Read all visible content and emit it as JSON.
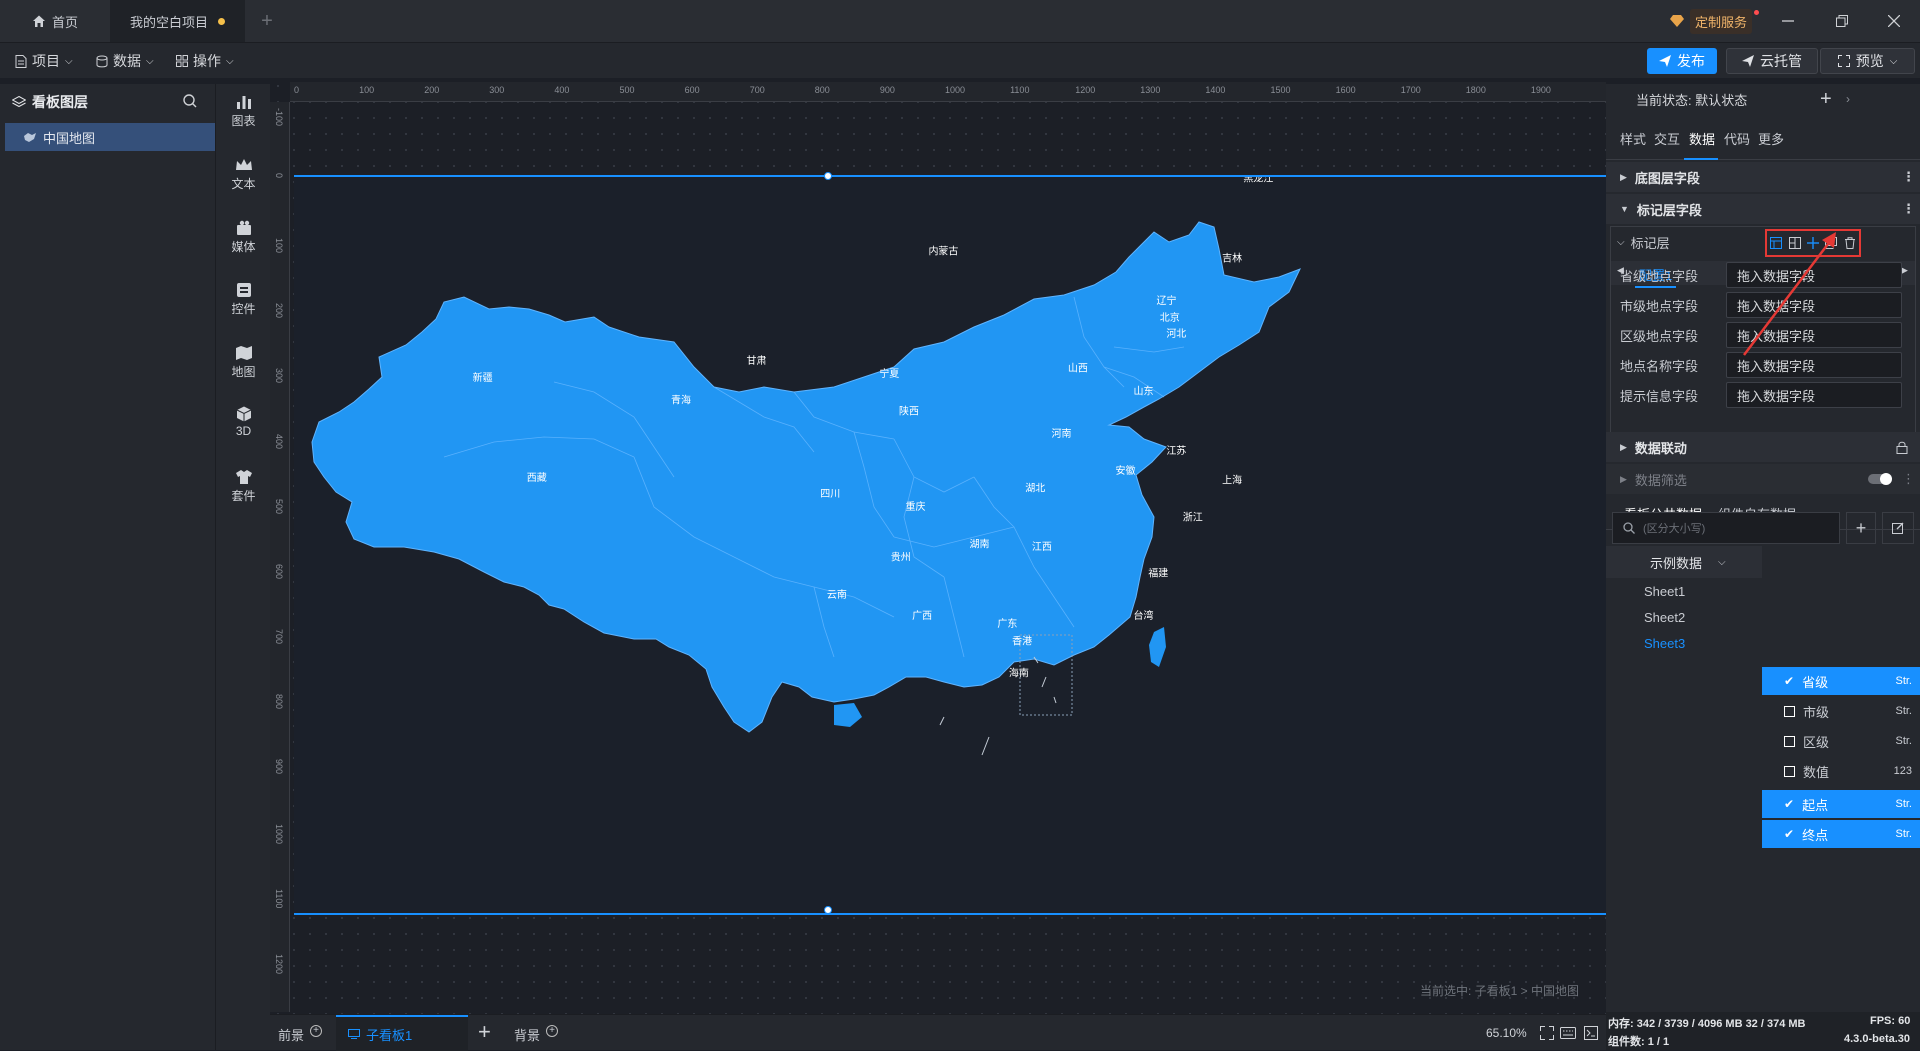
{
  "tabs": [
    {
      "label": "首页"
    },
    {
      "label": "我的空白项目"
    }
  ],
  "custom_service": "定制服务",
  "menu": {
    "project": "项目",
    "data": "数据",
    "operation": "操作"
  },
  "actions": {
    "publish": "发布",
    "cloud": "云托管",
    "preview": "预览"
  },
  "layers": {
    "title": "看板图层",
    "items": [
      "中国地图"
    ]
  },
  "tools": [
    "图表",
    "文本",
    "媒体",
    "控件",
    "地图",
    "3D",
    "套件"
  ],
  "ruler_h": [
    "0",
    "100",
    "200",
    "300",
    "400",
    "500",
    "600",
    "700",
    "800",
    "900",
    "1000",
    "1100",
    "1200",
    "1300",
    "1400",
    "1500",
    "1600",
    "1700",
    "1800",
    "1900"
  ],
  "ruler_v": [
    "-100",
    "0",
    "100",
    "200",
    "300",
    "400",
    "500",
    "600",
    "700",
    "800",
    "900",
    "1000",
    "1100",
    "1200"
  ],
  "map_labels": [
    "新疆",
    "西藏",
    "青海",
    "甘肃",
    "内蒙古",
    "黑龙江",
    "吉林",
    "辽宁",
    "北京",
    "河北",
    "山西",
    "山东",
    "宁夏",
    "陕西",
    "河南",
    "江苏",
    "上海",
    "安徽",
    "湖北",
    "四川",
    "重庆",
    "贵州",
    "湖南",
    "江西",
    "浙江",
    "福建",
    "云南",
    "广西",
    "广东",
    "香港",
    "台湾",
    "海南"
  ],
  "breadcrumb": "当前选中: 子看板1 > 中国地图",
  "bottom": {
    "front": "前景",
    "sub": "子看板1",
    "back": "背景",
    "zoom": "65.10%"
  },
  "status": {
    "memory": "内存: 342 / 3739 / 4096 MB 32 / 374 MB",
    "fps": "FPS: 60",
    "components": "组件数: 1 / 1",
    "version": "4.3.0-beta.30"
  },
  "right": {
    "state": "当前状态: 默认状态",
    "tabs": [
      "样式",
      "交互",
      "数据",
      "代码",
      "更多"
    ],
    "sections": {
      "base": "底图层字段",
      "mark": "标记层字段",
      "link": "数据联动",
      "filter": "数据筛选"
    },
    "mark_layer": "标记层",
    "config": "配置1",
    "fields": [
      {
        "label": "省级地点字段",
        "value": "拖入数据字段"
      },
      {
        "label": "市级地点字段",
        "value": "拖入数据字段"
      },
      {
        "label": "区级地点字段",
        "value": "拖入数据字段"
      },
      {
        "label": "地点名称字段",
        "value": "拖入数据字段"
      },
      {
        "label": "提示信息字段",
        "value": "拖入数据字段"
      }
    ],
    "data_tabs": [
      "看板公共数据",
      "组件自有数据"
    ],
    "search_placeholder": "(区分大小写)",
    "dataset": "示例数据",
    "sheets": [
      "Sheet1",
      "Sheet2",
      "Sheet3"
    ],
    "columns": [
      {
        "name": "省级",
        "type": "Str.",
        "checked": true
      },
      {
        "name": "市级",
        "type": "Str.",
        "checked": false
      },
      {
        "name": "区级",
        "type": "Str.",
        "checked": false
      },
      {
        "name": "数值",
        "type": "123",
        "checked": false
      },
      {
        "name": "起点",
        "type": "Str.",
        "checked": true
      },
      {
        "name": "终点",
        "type": "Str.",
        "checked": true
      }
    ]
  },
  "colors": {
    "accent": "#1890ff",
    "map": "#2196f3",
    "highlight": "#e53935"
  }
}
